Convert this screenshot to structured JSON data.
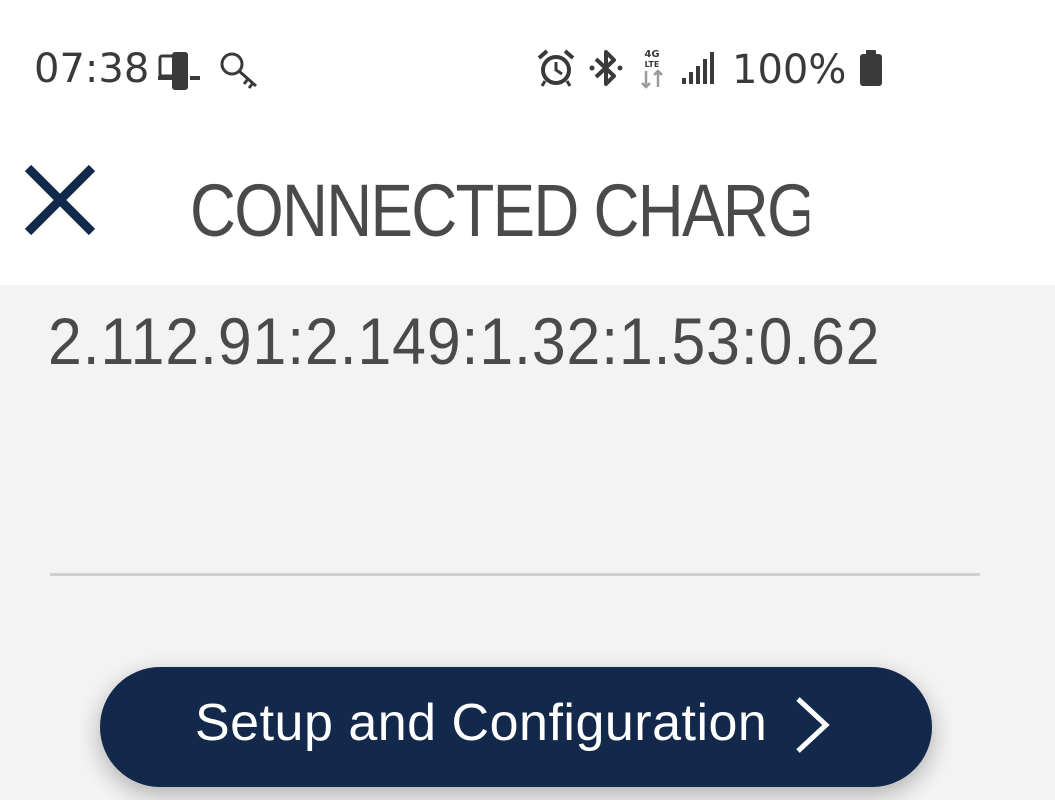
{
  "status_bar": {
    "time": "07:38",
    "left_icons": [
      "phone-tablet-icon",
      "key-icon"
    ],
    "right_icons": [
      "alarm-icon",
      "bluetooth-icon",
      "lte-data-icon",
      "signal-icon"
    ],
    "battery_percent": "100%",
    "battery_icon": "battery-full-icon"
  },
  "app_bar": {
    "close_icon": "close-icon",
    "title": "CONNECTED CHARGE..."
  },
  "content": {
    "version": "2.112.91:2.149:1.32:1.53:0.62",
    "setup_button": {
      "label": "Setup and Configuration",
      "icon": "chevron-right-icon"
    }
  },
  "colors": {
    "brand_navy": "#13294b",
    "content_background": "#f3f3f3",
    "text_gray": "#4a4a4a"
  }
}
